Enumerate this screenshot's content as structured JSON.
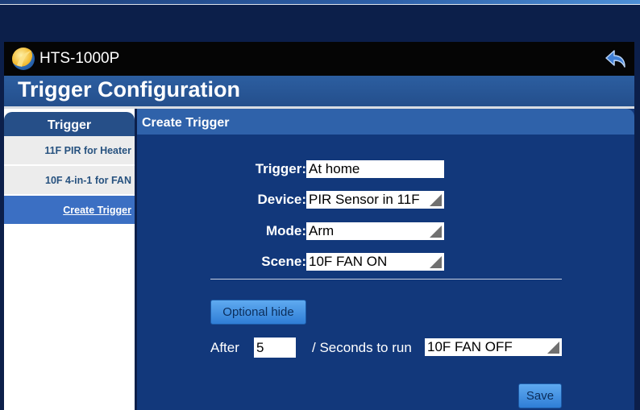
{
  "app": {
    "name": "HTS-1000P"
  },
  "page": {
    "title": "Trigger Configuration"
  },
  "sidebar": {
    "header": "Trigger",
    "items": [
      {
        "label": "11F PIR for Heater"
      },
      {
        "label": "10F 4-in-1 for FAN"
      },
      {
        "label": "Create Trigger"
      }
    ]
  },
  "main": {
    "header": "Create Trigger"
  },
  "form": {
    "trigger_label": "Trigger:",
    "trigger_value": "At home",
    "device_label": "Device:",
    "device_value": "PIR Sensor in 11F",
    "mode_label": "Mode:",
    "mode_value": "Arm",
    "scene_label": "Scene:",
    "scene_value": "10F FAN ON"
  },
  "optional": {
    "button_label": "Optional hide",
    "after_label": "After",
    "after_value": "5",
    "seconds_label": "/ Seconds to run",
    "run_scene_value": "10F FAN OFF"
  },
  "actions": {
    "save_label": "Save"
  },
  "colors": {
    "background": "#0c1f4a",
    "title_bar": "#2c5ea0",
    "panel": "#12387b",
    "active_item": "#3b6fc3",
    "button": "#4f9ae8"
  },
  "icons": {
    "logo": "app-logo-icon",
    "back": "back-arrow-icon"
  }
}
